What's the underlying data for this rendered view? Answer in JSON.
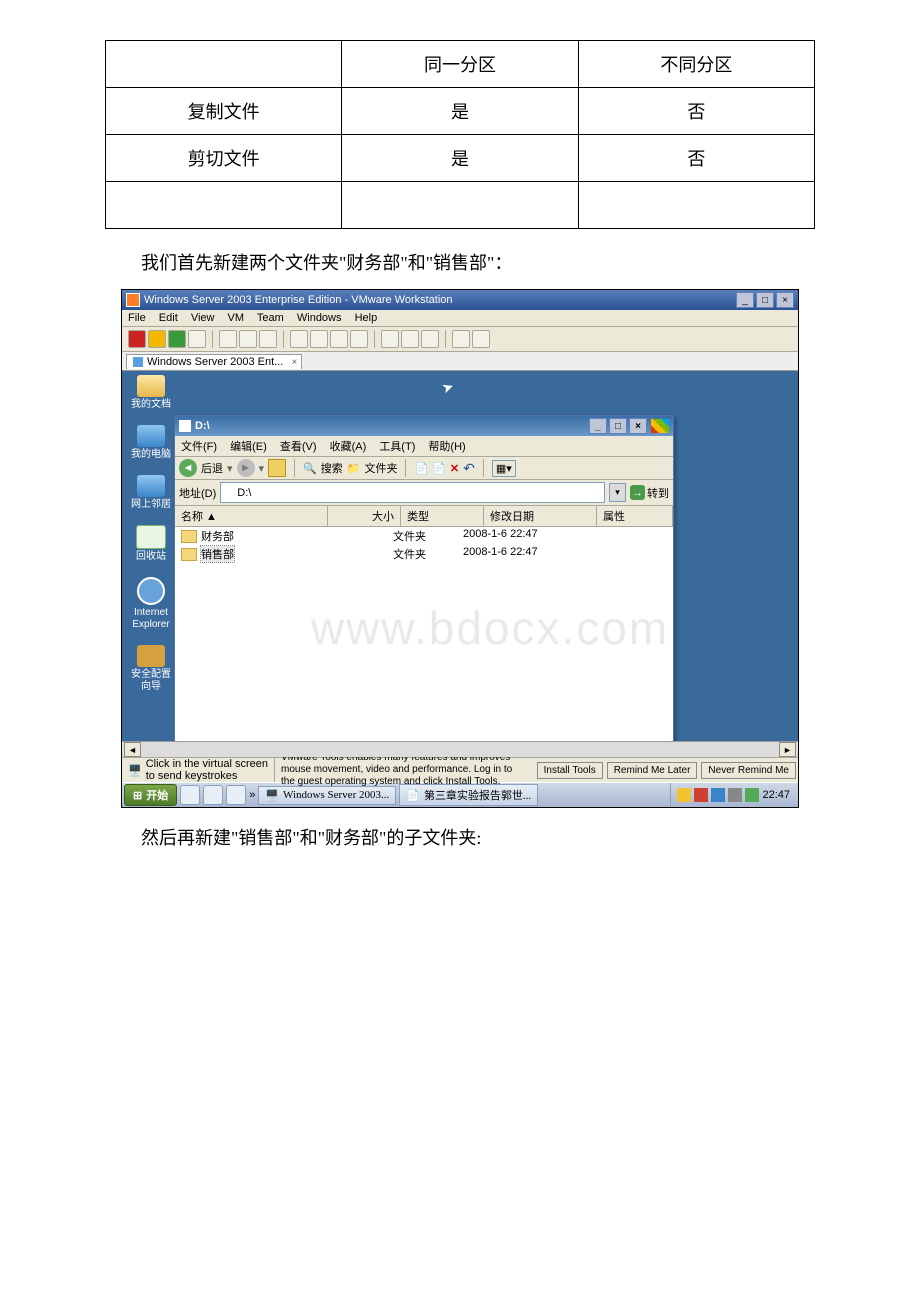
{
  "table": {
    "headers": [
      "",
      "同一分区",
      "不同分区"
    ],
    "rows": [
      [
        "复制文件",
        "是",
        "否"
      ],
      [
        "剪切文件",
        "是",
        "否"
      ],
      [
        "",
        "",
        ""
      ]
    ]
  },
  "para1": "我们首先新建两个文件夹\"财务部\"和\"销售部\"：",
  "para2": "然后再新建\"销售部\"和\"财务部\"的子文件夹:",
  "watermark": "www.bdocx.com",
  "vm": {
    "title": "Windows Server 2003 Enterprise Edition - VMware Workstation",
    "menu": [
      "File",
      "Edit",
      "View",
      "VM",
      "Team",
      "Windows",
      "Help"
    ],
    "tab": "Windows Server 2003 Ent...",
    "status_click": "Click in the virtual screen\nto send keystrokes",
    "status_msg": "VMware Tools enables many features and improves mouse movement, video and performance. Log in to the guest operating system and click Install Tools.",
    "btn_install": "Install Tools",
    "btn_remind": "Remind Me Later",
    "btn_never": "Never Remind Me"
  },
  "desktop": {
    "mydoc": "我的文档",
    "mycomp": "我的电脑",
    "net": "网上邻居",
    "recyc": "回收站",
    "ie": "Internet\nExplorer",
    "sec": "安全配置向导"
  },
  "explorer": {
    "title": "D:\\",
    "menu": [
      "文件(F)",
      "编辑(E)",
      "查看(V)",
      "收藏(A)",
      "工具(T)",
      "帮助(H)"
    ],
    "back": "后退",
    "search": "搜索",
    "folders": "文件夹",
    "address_label": "地址(D)",
    "address_value": "D:\\",
    "go": "转到",
    "cols": {
      "name": "名称 ▲",
      "size": "大小",
      "type": "类型",
      "date": "修改日期",
      "attr": "属性"
    },
    "rows": [
      {
        "name": "财务部",
        "type": "文件夹",
        "date": "2008-1-6 22:47"
      },
      {
        "name": "销售部",
        "type": "文件夹",
        "date": "2008-1-6 22:47"
      }
    ]
  },
  "taskbar": {
    "start": "开始",
    "items": [
      "Windows Server 2003...",
      "第三章实验报告郭世..."
    ],
    "time": "22:47"
  }
}
